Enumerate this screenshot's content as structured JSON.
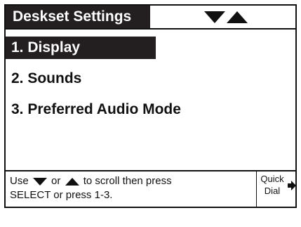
{
  "header": {
    "title": "Deskset Settings",
    "nav_icons": [
      "down-arrow-icon",
      "up-arrow-icon"
    ]
  },
  "menu": {
    "items": [
      {
        "label": "1. Display",
        "selected": true
      },
      {
        "label": "2. Sounds",
        "selected": false
      },
      {
        "label": "3. Preferred Audio Mode",
        "selected": false
      }
    ]
  },
  "hint": {
    "text_part1": "Use",
    "text_or": "or",
    "text_part2": "to scroll then press",
    "text_line2": "SELECT or press 1-3."
  },
  "softkey": {
    "line1": "Quick",
    "line2": "Dial",
    "icon": "right-arrow-icon"
  },
  "colors": {
    "highlight": "#231f20",
    "text": "#111111",
    "background": "#ffffff"
  }
}
